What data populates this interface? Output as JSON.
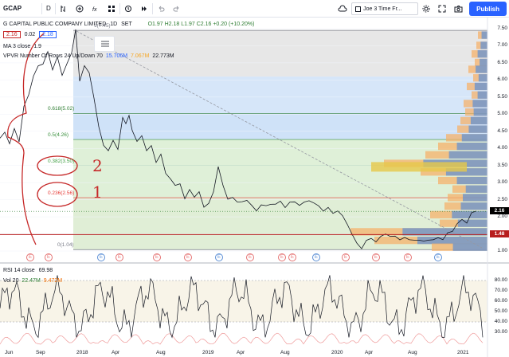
{
  "toolbar": {
    "symbol": "GCAP",
    "interval": "D",
    "layout_name": "Joe 3 Time Fr...",
    "publish_label": "Publish"
  },
  "legend": {
    "title": "G CAPITAL PUBLIC COMPANY LIMITED",
    "interval": "1D",
    "exchange": "SET",
    "ohlc": "O1.97 H2.18 L1.97 C2.16 +0.20 (+10.20%)",
    "bid": "2.16",
    "spread": "0.02",
    "ask": "2.18",
    "ma": "MA 3 close",
    "ma_value": "1.9",
    "vpvr": "VPVR Number Of Rows 24 Up/Down 70",
    "vpvr_up": "15.706M",
    "vpvr_down": "7.067M",
    "vpvr_total": "22.773M",
    "rsi": "RSI 14 close",
    "rsi_value": "69.98",
    "vol": "Vol 20",
    "vol_a": "22.47M",
    "vol_b": "9.472M"
  },
  "fib_levels": [
    {
      "label": "1(7.45)",
      "price": 7.45
    },
    {
      "label": "0.618(5.02)",
      "price": 5.02
    },
    {
      "label": "0.5(4.26)",
      "price": 4.26
    },
    {
      "label": "0.382(3.50)",
      "price": 3.5
    },
    {
      "label": "0.236(2.56)",
      "price": 2.56
    },
    {
      "label": "0(1.04)",
      "price": 1.04
    }
  ],
  "price_axis": [
    "7.50",
    "7.00",
    "6.50",
    "6.00",
    "5.50",
    "5.00",
    "4.50",
    "4.00",
    "3.50",
    "3.00",
    "2.50",
    "2.00",
    "1.50",
    "1.00"
  ],
  "current_price": "2.16",
  "line_price": "1.48",
  "rsi_axis": [
    "80.00",
    "70.00",
    "60.00",
    "50.00",
    "40.00",
    "30.00"
  ],
  "date_axis": [
    "Jun",
    "Sep",
    "2018",
    "Apr",
    "Aug",
    "2019",
    "Apr",
    "Aug",
    "2020",
    "Apr",
    "Aug",
    "2021"
  ],
  "annotations": {
    "mark_1": "1",
    "mark_2": "2"
  },
  "earnings_marker": "E",
  "colors": {
    "accent": "#2962ff",
    "price_tag": "#000000",
    "support_line": "#b71c1c",
    "fib_red": "#f8c9c9",
    "fib_blue": "#cfe2f8",
    "fib_green": "#dff0d8"
  }
}
